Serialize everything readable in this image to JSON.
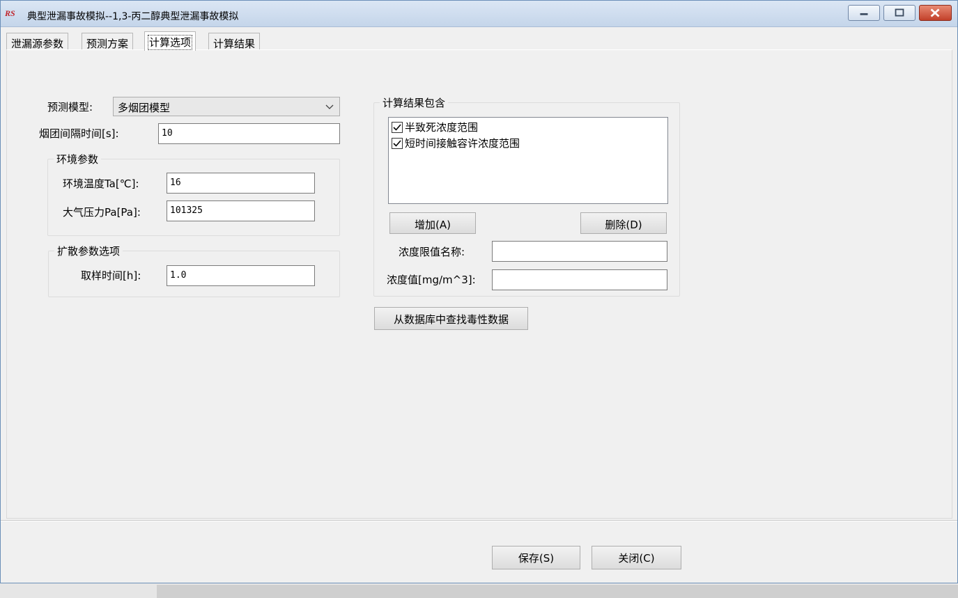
{
  "window": {
    "title": "典型泄漏事故模拟--1,3-丙二醇典型泄漏事故模拟",
    "logo_text": "RS"
  },
  "tabs": [
    {
      "label": "泄漏源参数",
      "active": false
    },
    {
      "label": "预测方案",
      "active": false
    },
    {
      "label": "计算选项",
      "active": true
    },
    {
      "label": "计算结果",
      "active": false
    }
  ],
  "form": {
    "model_label": "预测模型:",
    "model_value": "多烟团模型",
    "interval_label": "烟团间隔时间[s]:",
    "interval_value": "10",
    "env_group_title": "环境参数",
    "temp_label": "环境温度Ta[℃]:",
    "temp_value": "16",
    "pressure_label": "大气压力Pa[Pa]:",
    "pressure_value": "101325",
    "diffusion_group_title": "扩散参数选项",
    "sample_label": "取样时间[h]:",
    "sample_value": "1.0"
  },
  "results_group": {
    "title": "计算结果包含",
    "items": [
      {
        "label": "半致死浓度范围",
        "checked": true
      },
      {
        "label": "短时间接触容许浓度范围",
        "checked": true
      }
    ],
    "add_label": "增加(A)",
    "delete_label": "删除(D)",
    "limit_name_label": "浓度限值名称:",
    "limit_name_value": "",
    "conc_label": "浓度值[mg/m^3]:",
    "conc_value": ""
  },
  "lookup_button": "从数据库中查找毒性数据",
  "footer": {
    "save_label": "保存(S)",
    "close_label": "关闭(C)"
  }
}
